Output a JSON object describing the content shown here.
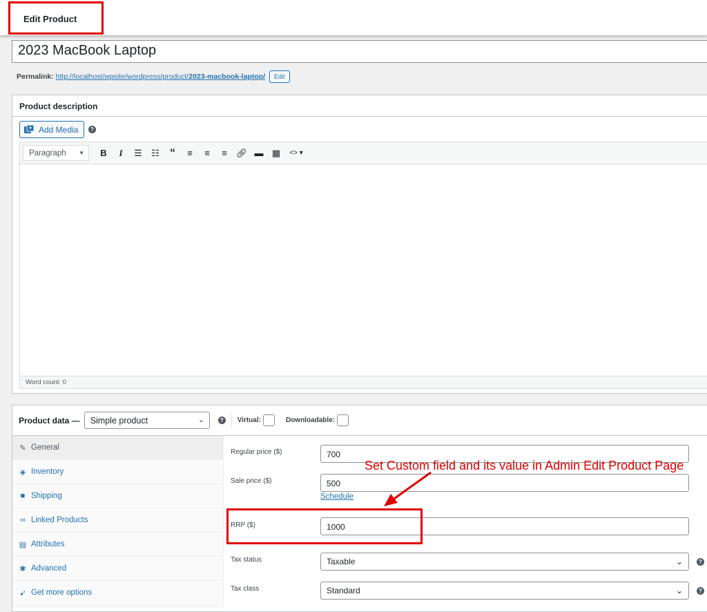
{
  "topbar": {
    "title": "Edit Product"
  },
  "product": {
    "title": "2023 MacBook Laptop",
    "permalink_label": "Permalink:",
    "permalink_base": "http://localhost/wpsite/wordpress/product/",
    "permalink_slug": "2023-macbook-laptop/",
    "permalink_edit": "Edit"
  },
  "description_box": {
    "title": "Product description",
    "add_media": "Add Media",
    "help": "?",
    "format_select": "Paragraph",
    "word_count": "Word count: 0",
    "toolbar_icons": [
      "bold-icon",
      "italic-icon",
      "bullet-list-icon",
      "numbered-list-icon",
      "blockquote-icon",
      "align-left-icon",
      "align-center-icon",
      "align-right-icon",
      "link-icon",
      "read-more-icon",
      "toolbar-toggle-icon",
      "code-icon"
    ]
  },
  "product_data": {
    "label": "Product data —",
    "type": "Simple product",
    "virtual_label": "Virtual:",
    "downloadable_label": "Downloadable:",
    "tabs": [
      {
        "label": "General",
        "icon": "wrench-icon"
      },
      {
        "label": "Inventory",
        "icon": "tag-icon"
      },
      {
        "label": "Shipping",
        "icon": "truck-icon"
      },
      {
        "label": "Linked Products",
        "icon": "link-icon"
      },
      {
        "label": "Attributes",
        "icon": "list-icon"
      },
      {
        "label": "Advanced",
        "icon": "gear-icon"
      },
      {
        "label": "Get more options",
        "icon": "plugin-icon"
      }
    ],
    "fields": {
      "regular_price_label": "Regular price ($)",
      "regular_price": "700",
      "sale_price_label": "Sale price ($)",
      "sale_price": "500",
      "schedule": "Schedule",
      "rrp_label": "RRP ($)",
      "rrp": "1000",
      "tax_status_label": "Tax status",
      "tax_status": "Taxable",
      "tax_class_label": "Tax class",
      "tax_class": "Standard"
    }
  },
  "annotation": {
    "text": "Set Custom field and its value in Admin Edit Product Page",
    "color": "#e00000"
  },
  "colors": {
    "link": "#2271b1",
    "highlight": "#e00000"
  }
}
